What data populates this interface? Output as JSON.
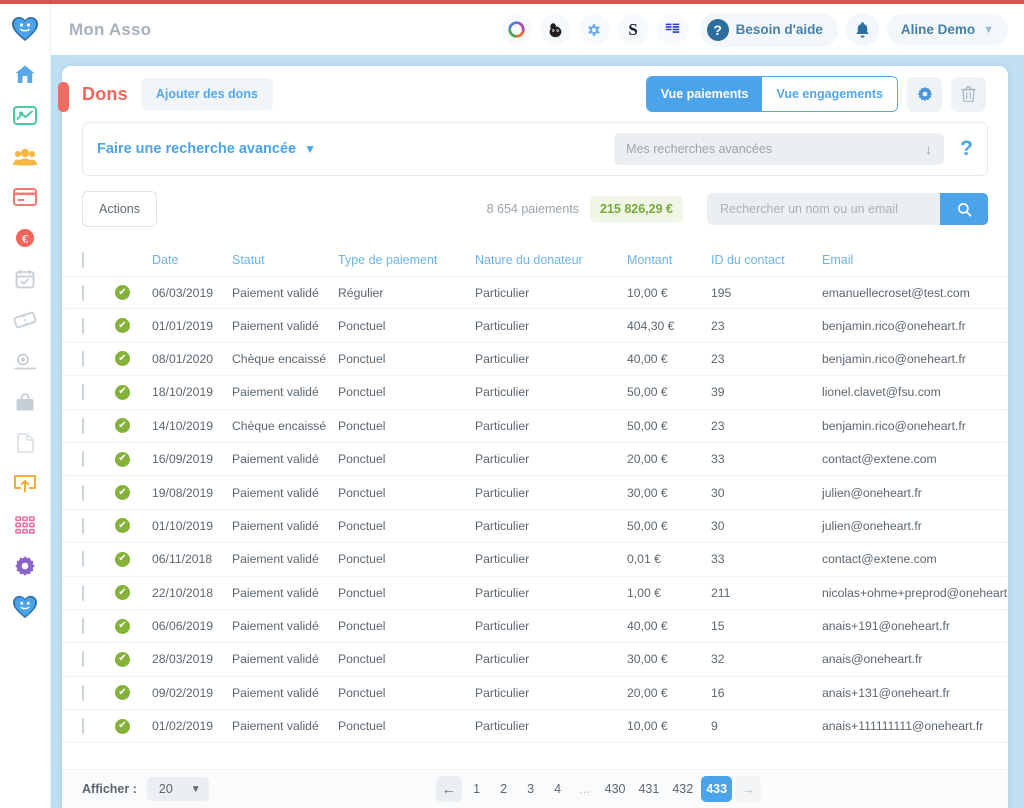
{
  "header": {
    "app_title": "Mon Asso",
    "integrations": [
      {
        "name": "hubspot-icon",
        "glyph": "◎"
      },
      {
        "name": "mailchimp-icon",
        "glyph": "🐵"
      },
      {
        "name": "sendinblue-icon",
        "glyph": "✺"
      },
      {
        "name": "stripe-icon",
        "glyph": "S"
      },
      {
        "name": "weezevent-icon",
        "glyph": "⊞"
      }
    ],
    "help_label": "Besoin d'aide",
    "help_icon": "question-mark-icon",
    "bell_icon": "notification-bell-icon",
    "user_name": "Aline Demo",
    "user_chevron": "chevron-down-icon"
  },
  "sidebar": {
    "logo": "oneheart-logo-icon",
    "items": [
      {
        "name": "home-icon",
        "color": "#5aa9e6"
      },
      {
        "name": "campaigns-icon",
        "color": "#4cc8a3"
      },
      {
        "name": "contacts-icon",
        "color": "#f5b740"
      },
      {
        "name": "payments-card-icon",
        "color": "#f07b72"
      },
      {
        "name": "donations-euro-icon",
        "color": "#f2655b"
      },
      {
        "name": "events-calendar-icon",
        "color": "#c7cfd6"
      },
      {
        "name": "tickets-icon",
        "color": "#c7cfd6"
      },
      {
        "name": "memberships-icon",
        "color": "#c7cfd6"
      },
      {
        "name": "shop-bag-icon",
        "color": "#c7cfd6"
      },
      {
        "name": "documents-icon",
        "color": "#c7cfd6"
      },
      {
        "name": "export-icon",
        "color": "#f0ad37"
      },
      {
        "name": "apps-grid-icon",
        "color": "#ef6fa0"
      },
      {
        "name": "settings-gear-icon",
        "color": "#8b63c9"
      },
      {
        "name": "oneheart-footer-icon",
        "color": "#4b9fe0"
      }
    ]
  },
  "page": {
    "title": "Dons",
    "add_button": "Ajouter des dons",
    "view_tabs": [
      {
        "label": "Vue paiements",
        "active": true
      },
      {
        "label": "Vue engagements",
        "active": false
      }
    ],
    "settings_icon": "gear-icon",
    "delete_icon": "trash-icon"
  },
  "advanced_search": {
    "link_label": "Faire une recherche avancée",
    "chevron": "chevron-down-icon",
    "saved_placeholder": "Mes recherches avancées",
    "download_icon": "arrow-down-icon",
    "help_icon": "question-mark-icon"
  },
  "toolbar": {
    "actions_label": "Actions",
    "count_label": "8 654 paiements",
    "amount_total": "215 826,29 €",
    "search_placeholder": "Rechercher un nom ou un email",
    "search_value": "",
    "search_icon": "magnifier-icon"
  },
  "table": {
    "columns": [
      "Date",
      "Statut",
      "Type de paiement",
      "Nature du donateur",
      "Montant",
      "ID du contact",
      "Email"
    ],
    "rows": [
      {
        "status": "valide",
        "date": "06/03/2019",
        "statut": "Paiement validé",
        "type": "Régulier",
        "nature": "Particulier",
        "montant": "10,00 €",
        "id": "195",
        "email": "emanuellecroset@test.com"
      },
      {
        "status": "valide",
        "date": "01/01/2019",
        "statut": "Paiement validé",
        "type": "Ponctuel",
        "nature": "Particulier",
        "montant": "404,30 €",
        "id": "23",
        "email": "benjamin.rico@oneheart.fr"
      },
      {
        "status": "valide",
        "date": "08/01/2020",
        "statut": "Chèque encaissé",
        "type": "Ponctuel",
        "nature": "Particulier",
        "montant": "40,00 €",
        "id": "23",
        "email": "benjamin.rico@oneheart.fr"
      },
      {
        "status": "valide",
        "date": "18/10/2019",
        "statut": "Paiement validé",
        "type": "Ponctuel",
        "nature": "Particulier",
        "montant": "50,00 €",
        "id": "39",
        "email": "lionel.clavet@fsu.com"
      },
      {
        "status": "valide",
        "date": "14/10/2019",
        "statut": "Chèque encaissé",
        "type": "Ponctuel",
        "nature": "Particulier",
        "montant": "50,00 €",
        "id": "23",
        "email": "benjamin.rico@oneheart.fr"
      },
      {
        "status": "valide",
        "date": "16/09/2019",
        "statut": "Paiement validé",
        "type": "Ponctuel",
        "nature": "Particulier",
        "montant": "20,00 €",
        "id": "33",
        "email": "contact@extene.com"
      },
      {
        "status": "valide",
        "date": "19/08/2019",
        "statut": "Paiement validé",
        "type": "Ponctuel",
        "nature": "Particulier",
        "montant": "30,00 €",
        "id": "30",
        "email": "julien@oneheart.fr"
      },
      {
        "status": "valide",
        "date": "01/10/2019",
        "statut": "Paiement validé",
        "type": "Ponctuel",
        "nature": "Particulier",
        "montant": "50,00 €",
        "id": "30",
        "email": "julien@oneheart.fr"
      },
      {
        "status": "valide",
        "date": "06/11/2018",
        "statut": "Paiement validé",
        "type": "Ponctuel",
        "nature": "Particulier",
        "montant": "0,01 €",
        "id": "33",
        "email": "contact@extene.com"
      },
      {
        "status": "valide",
        "date": "22/10/2018",
        "statut": "Paiement validé",
        "type": "Ponctuel",
        "nature": "Particulier",
        "montant": "1,00 €",
        "id": "211",
        "email": "nicolas+ohme+preprod@oneheart.fr"
      },
      {
        "status": "valide",
        "date": "06/06/2019",
        "statut": "Paiement validé",
        "type": "Ponctuel",
        "nature": "Particulier",
        "montant": "40,00 €",
        "id": "15",
        "email": "anais+191@oneheart.fr"
      },
      {
        "status": "valide",
        "date": "28/03/2019",
        "statut": "Paiement validé",
        "type": "Ponctuel",
        "nature": "Particulier",
        "montant": "30,00 €",
        "id": "32",
        "email": "anais@oneheart.fr"
      },
      {
        "status": "valide",
        "date": "09/02/2019",
        "statut": "Paiement validé",
        "type": "Ponctuel",
        "nature": "Particulier",
        "montant": "20,00 €",
        "id": "16",
        "email": "anais+131@oneheart.fr"
      },
      {
        "status": "valide",
        "date": "01/02/2019",
        "statut": "Paiement validé",
        "type": "Ponctuel",
        "nature": "Particulier",
        "montant": "10,00 €",
        "id": "9",
        "email": "anais+111111111@oneheart.fr"
      }
    ]
  },
  "footer": {
    "afficher_label": "Afficher :",
    "per_page": "20",
    "per_page_chevron": "chevron-down-icon",
    "prev_icon": "arrow-left-icon",
    "next_icon": "arrow-right-icon",
    "pages": [
      "1",
      "2",
      "3",
      "4",
      "...",
      "430",
      "431",
      "432",
      "433"
    ],
    "active_page": "433"
  },
  "colors": {
    "accent_blue": "#4ba3ea",
    "accent_red": "#f2655b",
    "status_green": "#85b23a",
    "amount_green": "#77a83a",
    "bg_blue": "#bfdff3"
  }
}
